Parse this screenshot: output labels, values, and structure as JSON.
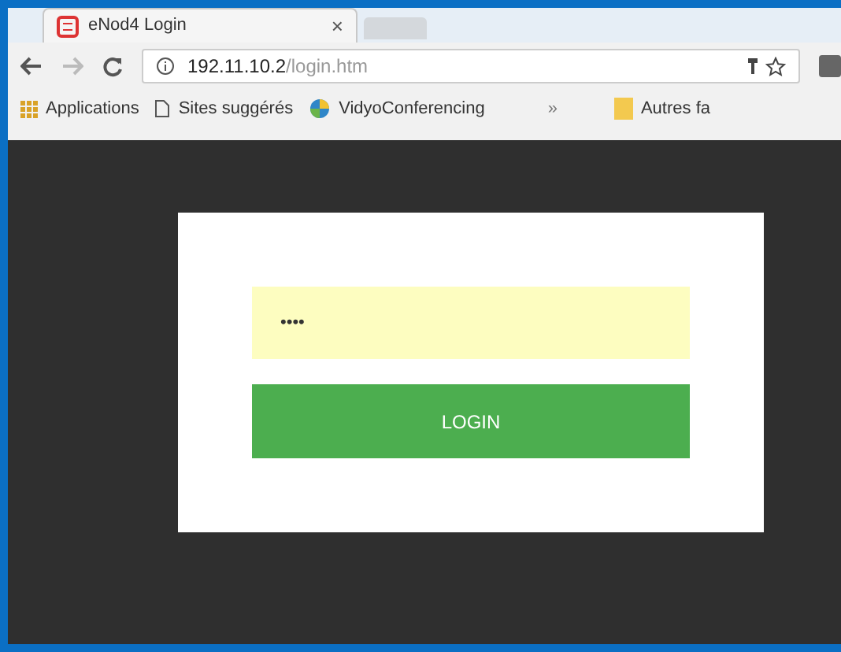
{
  "tab": {
    "title": "eNod4 Login",
    "close": "×"
  },
  "address_bar": {
    "host": "192.11.10.2",
    "path": "/login.htm"
  },
  "bookmarks": [
    {
      "label": "Applications",
      "kind": "apps"
    },
    {
      "label": "Sites suggérés",
      "kind": "page"
    },
    {
      "label": "VidyoConferencing",
      "kind": "globe"
    },
    {
      "label": "»",
      "kind": "more"
    },
    {
      "label": "Autres fa",
      "kind": "folder"
    }
  ],
  "login": {
    "password_value": "••••",
    "button": "LOGIN"
  }
}
